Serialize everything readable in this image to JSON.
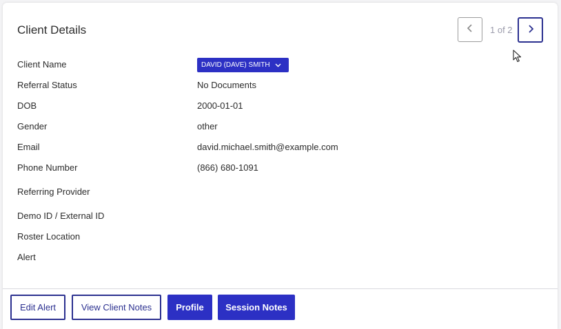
{
  "header": {
    "title": "Client Details",
    "pager": {
      "text": "1 of 2",
      "current": 1,
      "total": 2
    }
  },
  "fields": {
    "client_name": {
      "label": "Client Name",
      "value": "DAVID (DAVE) SMITH"
    },
    "referral_status": {
      "label": "Referral Status",
      "value": "No Documents"
    },
    "dob": {
      "label": "DOB",
      "value": "2000-01-01"
    },
    "gender": {
      "label": "Gender",
      "value": "other"
    },
    "email": {
      "label": "Email",
      "value": "david.michael.smith@example.com"
    },
    "phone": {
      "label": "Phone Number",
      "value": "(866) 680-1091"
    },
    "referring_provider": {
      "label": "Referring Provider",
      "value": ""
    },
    "demo_id": {
      "label": "Demo ID / External ID",
      "value": ""
    },
    "roster_location": {
      "label": "Roster Location",
      "value": ""
    },
    "alert": {
      "label": "Alert",
      "value": ""
    }
  },
  "footer": {
    "edit_alert": "Edit Alert",
    "view_client_notes": "View Client Notes",
    "profile": "Profile",
    "session_notes": "Session Notes"
  },
  "icons": {
    "prev": "chevron-left-icon",
    "next": "chevron-right-icon",
    "dropdown": "chevron-down-icon",
    "cursor": "mouse-cursor-icon"
  },
  "colors": {
    "accent": "#2c30c4",
    "accent_border": "#2a2f8f",
    "muted_text": "#9a9aaa"
  }
}
